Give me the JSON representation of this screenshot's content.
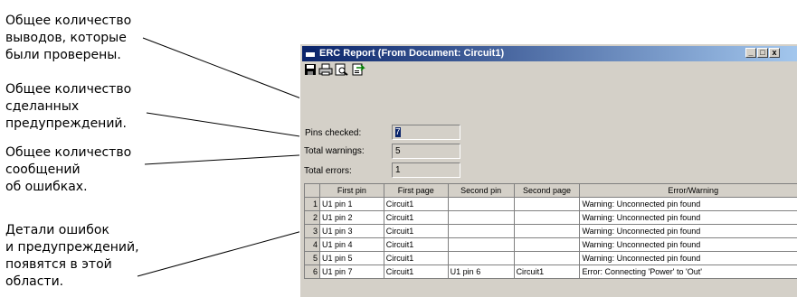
{
  "annotations": {
    "pins_checked": "Общее количество\nвыводов, которые\nбыли проверены.",
    "warnings": "Общее количество\nсделанных\nпредупреждений.",
    "errors": "Общее количество\nсообщений\nоб ошибках.",
    "details": "Детали ошибок\nи предупреждений,\nпоявятся в этой\nобласти."
  },
  "window": {
    "title": "ERC Report (From Document: Circuit1)",
    "controls": {
      "minimize": "_",
      "maximize": "□",
      "close": "x"
    }
  },
  "toolbar": {
    "icons": [
      "save-icon",
      "print-icon",
      "print-preview-icon",
      "export-icon"
    ]
  },
  "summary": {
    "pins_label": "Pins checked:",
    "pins_value": "7",
    "warnings_label": "Total warnings:",
    "warnings_value": "5",
    "errors_label": "Total errors:",
    "errors_value": "1"
  },
  "grid": {
    "columns": [
      "First pin",
      "First page",
      "Second pin",
      "Second page",
      "Error/Warning"
    ],
    "rows": [
      {
        "n": "1",
        "first_pin": "U1 pin 1",
        "first_page": "Circuit1",
        "second_pin": "",
        "second_page": "",
        "message": "Warning: Unconnected pin found"
      },
      {
        "n": "2",
        "first_pin": "U1 pin 2",
        "first_page": "Circuit1",
        "second_pin": "",
        "second_page": "",
        "message": "Warning: Unconnected pin found"
      },
      {
        "n": "3",
        "first_pin": "U1 pin 3",
        "first_page": "Circuit1",
        "second_pin": "",
        "second_page": "",
        "message": "Warning: Unconnected pin found"
      },
      {
        "n": "4",
        "first_pin": "U1 pin 4",
        "first_page": "Circuit1",
        "second_pin": "",
        "second_page": "",
        "message": "Warning: Unconnected pin found"
      },
      {
        "n": "5",
        "first_pin": "U1 pin 5",
        "first_page": "Circuit1",
        "second_pin": "",
        "second_page": "",
        "message": "Warning: Unconnected pin found"
      },
      {
        "n": "6",
        "first_pin": "U1 pin 7",
        "first_page": "Circuit1",
        "second_pin": "U1 pin 6",
        "second_page": "Circuit1",
        "message": "Error: Connecting 'Power' to 'Out'"
      }
    ]
  }
}
